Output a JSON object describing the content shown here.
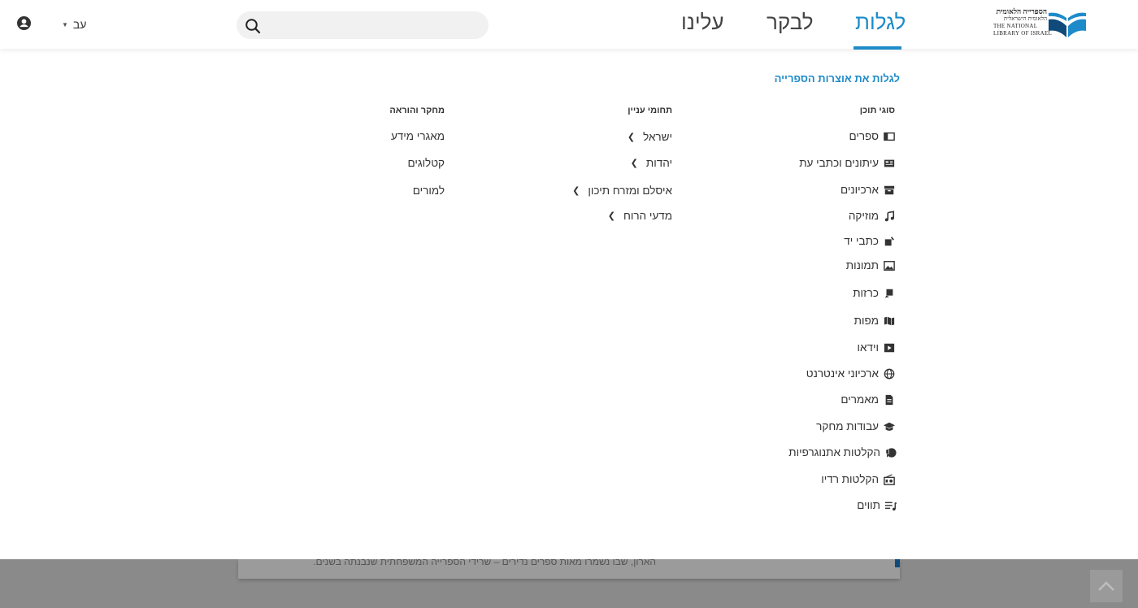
{
  "header": {
    "language": "עב",
    "search": {
      "value": "",
      "placeholder": ""
    },
    "nav": [
      {
        "label": "לגלות",
        "active": true
      },
      {
        "label": "לבקר",
        "active": false
      },
      {
        "label": "עלינו",
        "active": false
      }
    ],
    "logo": {
      "line1": "הספרייה הלאומית",
      "line2": "הלאומית הישראלית",
      "line3": "THE NATIONAL",
      "line4": "LIBRARY OF ISRAEL"
    }
  },
  "menu": {
    "title": "לגלות את אוצרות הספרייה",
    "content_types": {
      "heading": "סוגי תוכן",
      "items": [
        {
          "label": "ספרים",
          "icon": "book-icon"
        },
        {
          "label": "עיתונים וכתבי עת",
          "icon": "newspaper-icon"
        },
        {
          "label": "ארכיונים",
          "icon": "archive-box-icon"
        },
        {
          "label": "מוזיקה",
          "icon": "music-note-icon"
        },
        {
          "label": "כתבי יד",
          "icon": "manuscript-icon"
        },
        {
          "label": "תמונות",
          "icon": "image-icon"
        },
        {
          "label": "כרזות",
          "icon": "poster-icon"
        },
        {
          "label": "מפות",
          "icon": "map-icon"
        },
        {
          "label": "וידאו",
          "icon": "video-icon"
        },
        {
          "label": "ארכיוני אינטרנט",
          "icon": "globe-icon"
        },
        {
          "label": "מאמרים",
          "icon": "document-icon"
        },
        {
          "label": "עבודות מחקר",
          "icon": "graduation-cap-icon"
        },
        {
          "label": "הקלטות אתנוגרפיות",
          "icon": "globe-mic-icon"
        },
        {
          "label": "הקלטות רדיו",
          "icon": "radio-icon"
        },
        {
          "label": "תווים",
          "icon": "sheet-music-icon"
        }
      ]
    },
    "topics": {
      "heading": "תחומי עניין",
      "items": [
        {
          "label": "ישראל"
        },
        {
          "label": "יהדות"
        },
        {
          "label": "איסלם ומזרח תיכון"
        },
        {
          "label": "מדעי הרוח"
        }
      ]
    },
    "research": {
      "heading": "מחקר והוראה",
      "items": [
        {
          "label": "מאגרי מידע"
        },
        {
          "label": "קטלוגים"
        },
        {
          "label": "למורים"
        }
      ]
    }
  },
  "background_page": {
    "text": "הארון, שבו נשמרו מאות ספרים נדירים – שרידי הספרייה המשפחתית שנבנתה בשנים."
  },
  "colors": {
    "accent": "#1d8bc9",
    "logo_dark": "#104a7a",
    "overlay": "#8a8a8a"
  }
}
